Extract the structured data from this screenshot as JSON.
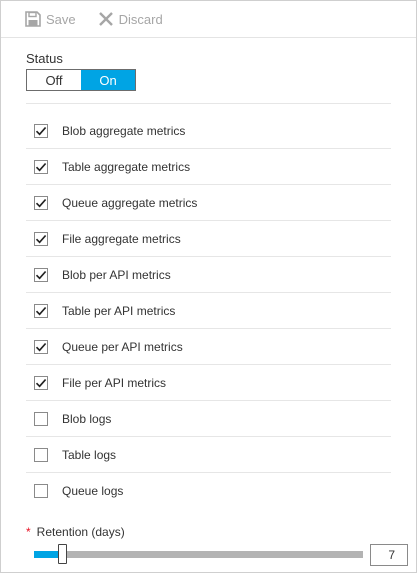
{
  "toolbar": {
    "save_label": "Save",
    "save_icon": "floppy-disk-icon",
    "discard_label": "Discard",
    "discard_icon": "x-icon",
    "disabled_color": "#a6a6a6"
  },
  "status": {
    "label": "Status",
    "off_label": "Off",
    "on_label": "On",
    "selected": "On",
    "accent_color": "#00a4e4"
  },
  "metrics": [
    {
      "label": "Blob aggregate metrics",
      "checked": true
    },
    {
      "label": "Table aggregate metrics",
      "checked": true
    },
    {
      "label": "Queue aggregate metrics",
      "checked": true
    },
    {
      "label": "File aggregate metrics",
      "checked": true
    },
    {
      "label": "Blob per API metrics",
      "checked": true
    },
    {
      "label": "Table per API metrics",
      "checked": true
    },
    {
      "label": "Queue per API metrics",
      "checked": true
    },
    {
      "label": "File per API metrics",
      "checked": true
    },
    {
      "label": "Blob logs",
      "checked": false
    },
    {
      "label": "Table logs",
      "checked": false
    },
    {
      "label": "Queue logs",
      "checked": false
    }
  ],
  "retention": {
    "required_mark": "*",
    "label": "Retention (days)",
    "value": "7",
    "slider_fraction": 0.085,
    "required_color": "#e81123"
  }
}
